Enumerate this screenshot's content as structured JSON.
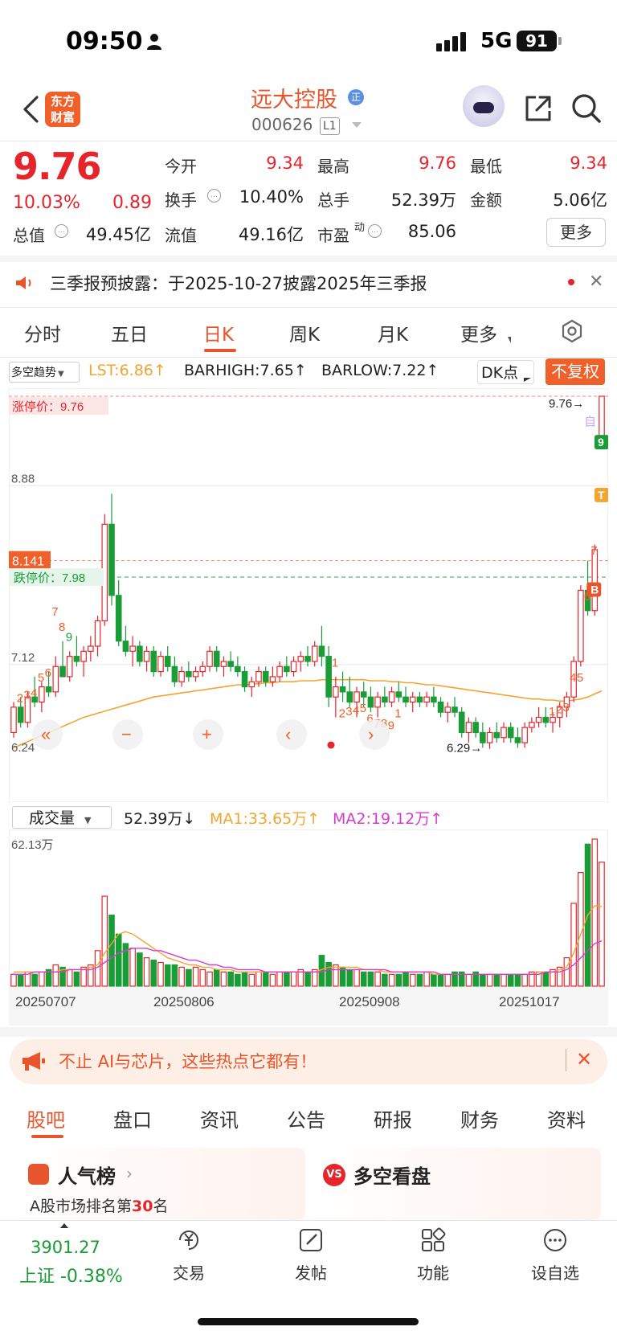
{
  "status_bar": {
    "time": "09:50",
    "network": "5G",
    "battery": "91"
  },
  "header": {
    "logo_text": "东方财富",
    "stock_name": "远大控股",
    "badge": "正",
    "stock_code": "000626",
    "market_tag": "L1"
  },
  "quote": {
    "price": "9.76",
    "change_pct": "10.03%",
    "change": "0.89",
    "open_label": "今开",
    "open": "9.34",
    "high_label": "最高",
    "high": "9.76",
    "low_label": "最低",
    "low": "9.34",
    "turnover_label": "换手",
    "turnover": "10.40%",
    "volume_label": "总手",
    "volume": "52.39万",
    "amount_label": "金额",
    "amount": "5.06亿",
    "mcap_label": "总值",
    "mcap": "49.45亿",
    "float_label": "流值",
    "float": "49.16亿",
    "pe_label": "市盈",
    "pe_super": "动",
    "pe": "85.06",
    "more": "更多"
  },
  "notice": {
    "text": "三季报预披露：于2025-10-27披露2025年三季报"
  },
  "period_tabs": [
    "分时",
    "五日",
    "日K",
    "周K",
    "月K",
    "更多"
  ],
  "indicator": {
    "select": "多空趋势",
    "lst": "LST:6.86↑",
    "barhigh": "BARHIGH:7.65↑",
    "barlow": "BARLOW:7.22↑",
    "dk": "DK点",
    "adjust": "不复权"
  },
  "kline_labels": {
    "limit_up": "涨停价：9.76",
    "limit_down": "跌停价：7.98",
    "y_top": "9.76",
    "y_mid": "8.88",
    "y_low": "7.12",
    "y_min": "6.24",
    "current_tag": "8.141",
    "max_label": "9.76",
    "min_label": "6.29",
    "self_tag": "自"
  },
  "volume_labels": {
    "select": "成交量",
    "value": "52.39万↓",
    "ma1": "MA1:33.65万↑",
    "ma2": "MA2:19.12万↑",
    "y_max": "62.13万"
  },
  "chart_data": {
    "type": "candlestick",
    "x_tick_labels": [
      "20250707",
      "20250806",
      "20250908",
      "20251017"
    ],
    "price_axis": {
      "ticks": [
        "9.76",
        "8.88",
        "7.12",
        "6.24"
      ],
      "ylim": [
        6.24,
        9.76
      ]
    },
    "volume_axis": {
      "max_label": "62.13万"
    },
    "ohlc": [
      [
        6.45,
        6.75,
        6.4,
        6.7
      ],
      [
        6.7,
        6.8,
        6.5,
        6.55
      ],
      [
        6.55,
        6.85,
        6.5,
        6.8
      ],
      [
        6.8,
        7.0,
        6.7,
        6.75
      ],
      [
        6.75,
        6.95,
        6.65,
        6.9
      ],
      [
        6.9,
        7.05,
        6.8,
        6.85
      ],
      [
        6.85,
        7.2,
        6.8,
        7.1
      ],
      [
        7.1,
        7.35,
        7.0,
        7.0
      ],
      [
        7.0,
        7.25,
        6.95,
        7.2
      ],
      [
        7.2,
        7.4,
        7.1,
        7.15
      ],
      [
        7.15,
        7.3,
        7.0,
        7.25
      ],
      [
        7.25,
        7.4,
        7.15,
        7.3
      ],
      [
        7.3,
        7.6,
        7.2,
        7.55
      ],
      [
        7.55,
        8.6,
        7.5,
        8.5
      ],
      [
        8.5,
        8.8,
        7.7,
        7.8
      ],
      [
        7.8,
        7.95,
        7.3,
        7.35
      ],
      [
        7.35,
        7.5,
        7.2,
        7.25
      ],
      [
        7.25,
        7.4,
        7.1,
        7.3
      ],
      [
        7.3,
        7.35,
        7.1,
        7.15
      ],
      [
        7.15,
        7.3,
        7.05,
        7.25
      ],
      [
        7.25,
        7.3,
        7.0,
        7.05
      ],
      [
        7.05,
        7.25,
        7.0,
        7.2
      ],
      [
        7.2,
        7.3,
        7.05,
        7.1
      ],
      [
        7.1,
        7.2,
        6.9,
        6.95
      ],
      [
        6.95,
        7.1,
        6.9,
        7.05
      ],
      [
        7.05,
        7.15,
        6.95,
        7.0
      ],
      [
        7.0,
        7.1,
        6.95,
        7.05
      ],
      [
        7.05,
        7.15,
        7.0,
        7.1
      ],
      [
        7.1,
        7.3,
        7.05,
        7.25
      ],
      [
        7.25,
        7.3,
        7.05,
        7.1
      ],
      [
        7.1,
        7.2,
        7.0,
        7.15
      ],
      [
        7.15,
        7.25,
        7.05,
        7.1
      ],
      [
        7.1,
        7.2,
        7.0,
        7.05
      ],
      [
        7.05,
        7.1,
        6.85,
        6.9
      ],
      [
        6.9,
        7.0,
        6.8,
        6.95
      ],
      [
        6.95,
        7.1,
        6.9,
        7.05
      ],
      [
        7.05,
        7.1,
        6.9,
        6.95
      ],
      [
        6.95,
        7.1,
        6.9,
        7.0
      ],
      [
        7.0,
        7.15,
        6.95,
        7.1
      ],
      [
        7.1,
        7.2,
        7.0,
        7.05
      ],
      [
        7.05,
        7.2,
        7.0,
        7.15
      ],
      [
        7.15,
        7.25,
        7.05,
        7.2
      ],
      [
        7.2,
        7.3,
        7.1,
        7.15
      ],
      [
        7.15,
        7.35,
        7.1,
        7.3
      ],
      [
        7.3,
        7.5,
        7.1,
        7.2
      ],
      [
        7.2,
        7.3,
        6.7,
        6.8
      ],
      [
        6.8,
        7.0,
        6.6,
        6.9
      ],
      [
        6.9,
        7.05,
        6.75,
        6.85
      ],
      [
        6.85,
        7.0,
        6.7,
        6.75
      ],
      [
        6.75,
        6.9,
        6.6,
        6.85
      ],
      [
        6.85,
        6.95,
        6.7,
        6.8
      ],
      [
        6.8,
        6.9,
        6.65,
        6.7
      ],
      [
        6.7,
        6.85,
        6.6,
        6.8
      ],
      [
        6.8,
        6.9,
        6.7,
        6.75
      ],
      [
        6.75,
        6.9,
        6.7,
        6.85
      ],
      [
        6.85,
        6.95,
        6.75,
        6.8
      ],
      [
        6.8,
        6.9,
        6.7,
        6.75
      ],
      [
        6.75,
        6.85,
        6.65,
        6.8
      ],
      [
        6.8,
        6.85,
        6.7,
        6.75
      ],
      [
        6.75,
        6.85,
        6.7,
        6.8
      ],
      [
        6.8,
        6.9,
        6.7,
        6.75
      ],
      [
        6.75,
        6.8,
        6.6,
        6.65
      ],
      [
        6.65,
        6.75,
        6.55,
        6.7
      ],
      [
        6.7,
        6.8,
        6.6,
        6.65
      ],
      [
        6.65,
        6.7,
        6.4,
        6.45
      ],
      [
        6.45,
        6.6,
        6.35,
        6.55
      ],
      [
        6.55,
        6.6,
        6.4,
        6.45
      ],
      [
        6.45,
        6.55,
        6.3,
        6.35
      ],
      [
        6.35,
        6.5,
        6.29,
        6.45
      ],
      [
        6.45,
        6.55,
        6.35,
        6.4
      ],
      [
        6.4,
        6.55,
        6.35,
        6.5
      ],
      [
        6.5,
        6.55,
        6.35,
        6.4
      ],
      [
        6.4,
        6.5,
        6.3,
        6.35
      ],
      [
        6.35,
        6.55,
        6.3,
        6.5
      ],
      [
        6.5,
        6.6,
        6.45,
        6.55
      ],
      [
        6.55,
        6.7,
        6.5,
        6.6
      ],
      [
        6.6,
        6.7,
        6.5,
        6.55
      ],
      [
        6.55,
        6.65,
        6.45,
        6.6
      ],
      [
        6.6,
        6.75,
        6.5,
        6.7
      ],
      [
        6.7,
        6.85,
        6.6,
        6.8
      ],
      [
        6.8,
        7.2,
        6.75,
        7.15
      ],
      [
        7.15,
        7.9,
        7.1,
        7.85
      ],
      [
        7.85,
        8.141,
        7.6,
        7.65
      ],
      [
        7.65,
        8.3,
        7.6,
        8.25
      ],
      [
        9.34,
        9.76,
        9.34,
        9.76
      ]
    ],
    "volume_wan": [
      5,
      5,
      6,
      5,
      6,
      7,
      9,
      8,
      7,
      6,
      8,
      9,
      15,
      38,
      30,
      22,
      18,
      16,
      14,
      12,
      11,
      10,
      9,
      9,
      8,
      7,
      8,
      7,
      6,
      7,
      6,
      6,
      5,
      6,
      5,
      6,
      6,
      5,
      6,
      6,
      6,
      7,
      6,
      7,
      13,
      10,
      9,
      8,
      7,
      7,
      6,
      6,
      6,
      5,
      5,
      5,
      6,
      5,
      5,
      6,
      5,
      5,
      5,
      6,
      6,
      5,
      6,
      5,
      5,
      5,
      5,
      5,
      5,
      5,
      6,
      6,
      6,
      7,
      8,
      12,
      35,
      48,
      60,
      62.13,
      52.39
    ],
    "ma1_wan": [
      6,
      6,
      6,
      6,
      6,
      6,
      6,
      7,
      7,
      7,
      7,
      8,
      9,
      14,
      18,
      22,
      23,
      22,
      20,
      18,
      16,
      14,
      12,
      11,
      10,
      9,
      9,
      8,
      8,
      7,
      7,
      7,
      6,
      6,
      6,
      6,
      6,
      6,
      6,
      6,
      6,
      6,
      6,
      6,
      7,
      8,
      8,
      8,
      8,
      8,
      7,
      7,
      7,
      6,
      6,
      6,
      6,
      6,
      6,
      6,
      5,
      5,
      5,
      5,
      5,
      5,
      5,
      5,
      5,
      5,
      5,
      5,
      5,
      5,
      5,
      6,
      6,
      6,
      7,
      8,
      14,
      22,
      30,
      34,
      33.65
    ],
    "ma2_wan": [
      5,
      5,
      5,
      6,
      6,
      6,
      6,
      6,
      7,
      7,
      7,
      7,
      8,
      10,
      12,
      14,
      15,
      16,
      16,
      16,
      15,
      15,
      14,
      13,
      12,
      11,
      11,
      10,
      9,
      9,
      8,
      8,
      7,
      7,
      7,
      7,
      6,
      6,
      6,
      6,
      6,
      6,
      6,
      6,
      6,
      7,
      7,
      7,
      7,
      7,
      7,
      7,
      7,
      7,
      6,
      6,
      6,
      6,
      6,
      6,
      6,
      5,
      5,
      5,
      5,
      5,
      5,
      5,
      5,
      5,
      5,
      5,
      5,
      5,
      5,
      5,
      6,
      6,
      6,
      7,
      9,
      12,
      15,
      18,
      19.12
    ],
    "lst_line": [
      6.3,
      6.33,
      6.36,
      6.39,
      6.42,
      6.45,
      6.48,
      6.51,
      6.54,
      6.57,
      6.6,
      6.62,
      6.64,
      6.66,
      6.68,
      6.7,
      6.72,
      6.74,
      6.76,
      6.78,
      6.8,
      6.81,
      6.82,
      6.83,
      6.84,
      6.85,
      6.86,
      6.87,
      6.88,
      6.89,
      6.9,
      6.91,
      6.92,
      6.92,
      6.93,
      6.93,
      6.94,
      6.94,
      6.95,
      6.95,
      6.95,
      6.96,
      6.96,
      6.96,
      6.97,
      6.97,
      6.97,
      6.97,
      6.97,
      6.97,
      6.97,
      6.96,
      6.96,
      6.96,
      6.95,
      6.95,
      6.94,
      6.94,
      6.93,
      6.92,
      6.92,
      6.91,
      6.9,
      6.89,
      6.88,
      6.87,
      6.86,
      6.85,
      6.84,
      6.83,
      6.82,
      6.81,
      6.8,
      6.79,
      6.78,
      6.78,
      6.77,
      6.77,
      6.76,
      6.76,
      6.77,
      6.78,
      6.8,
      6.83,
      6.86
    ],
    "limit_up": 9.76,
    "limit_down": 7.98,
    "current_line": 8.141,
    "markers": [
      "2",
      "3",
      "4",
      "5",
      "6",
      "7",
      "8",
      "9",
      "1",
      "2",
      "3",
      "4",
      "5",
      "6",
      "7",
      "8",
      "9",
      "1",
      "2",
      "3",
      "4",
      "5",
      "6",
      "7",
      "8",
      "9",
      "B",
      "T"
    ]
  },
  "promo": {
    "text": "不止 AI与芯片，这些热点它都有！"
  },
  "content_tabs": [
    "股吧",
    "盘口",
    "资讯",
    "公告",
    "研报",
    "财务",
    "资料"
  ],
  "cards": {
    "rank_title": "人气榜",
    "rank_sub_prefix": "A股市场排名第",
    "rank_num": "30",
    "rank_sub_suffix": "名",
    "vs_title": "多空看盘",
    "vs_icon": "VS"
  },
  "bottom_nav": {
    "index_value": "3901.27",
    "index_label": "上证 -0.38%",
    "items": [
      "交易",
      "发帖",
      "功能",
      "设自选"
    ]
  },
  "colors": {
    "up": "#e6242b",
    "down": "#1a9c37",
    "accent": "#e8552c",
    "ma1": "#f3a532",
    "ma2": "#d93bd1"
  }
}
